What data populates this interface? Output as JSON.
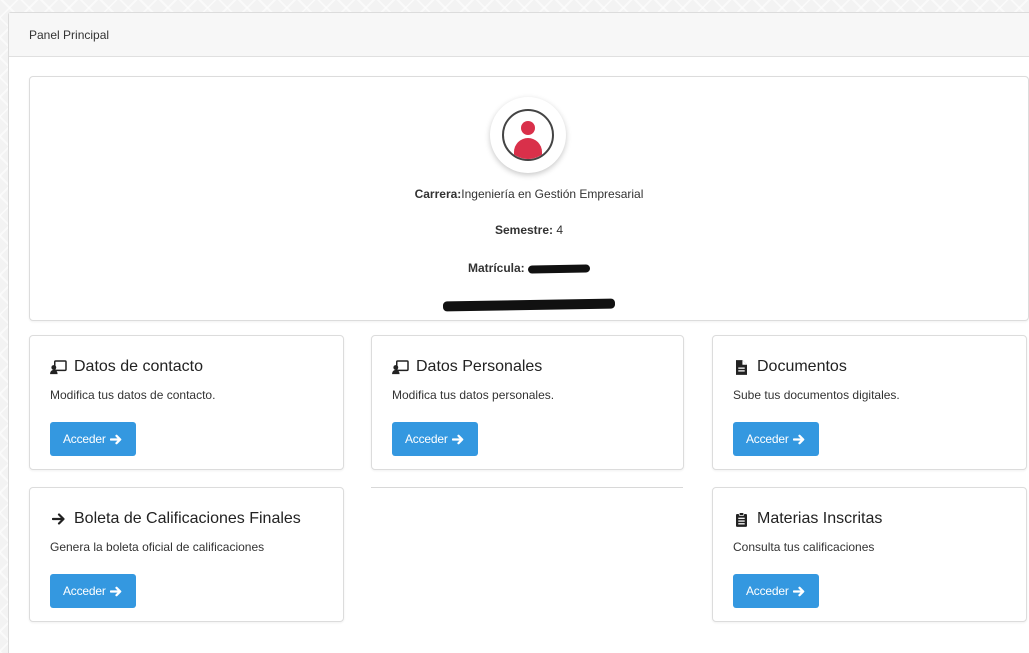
{
  "panel": {
    "title": "Panel Principal"
  },
  "profile": {
    "carrera_label": "Carrera:",
    "carrera_value": "Ingeniería en Gestión Empresarial",
    "semestre_label": "Semestre:",
    "semestre_value": "4",
    "matricula_label": "Matrícula:"
  },
  "cards": [
    {
      "title": "Datos de contacto",
      "desc": "Modifica tus datos de contacto.",
      "button": "Acceder",
      "icon": "contact-card-icon"
    },
    {
      "title": "Datos Personales",
      "desc": "Modifica tus datos personales.",
      "button": "Acceder",
      "icon": "contact-card-icon"
    },
    {
      "title": "Documentos",
      "desc": "Sube tus documentos digitales.",
      "button": "Acceder",
      "icon": "file-icon"
    },
    {
      "title": "Boleta de Calificaciones Finales",
      "desc": "Genera la boleta oficial de calificaciones",
      "button": "Acceder",
      "icon": "arrow-right-icon"
    },
    {
      "title": "Materias Inscritas",
      "desc": "Consulta tus calificaciones",
      "button": "Acceder",
      "icon": "clipboard-icon"
    }
  ],
  "colors": {
    "accent": "#3498e0",
    "avatar": "#d9304a"
  }
}
